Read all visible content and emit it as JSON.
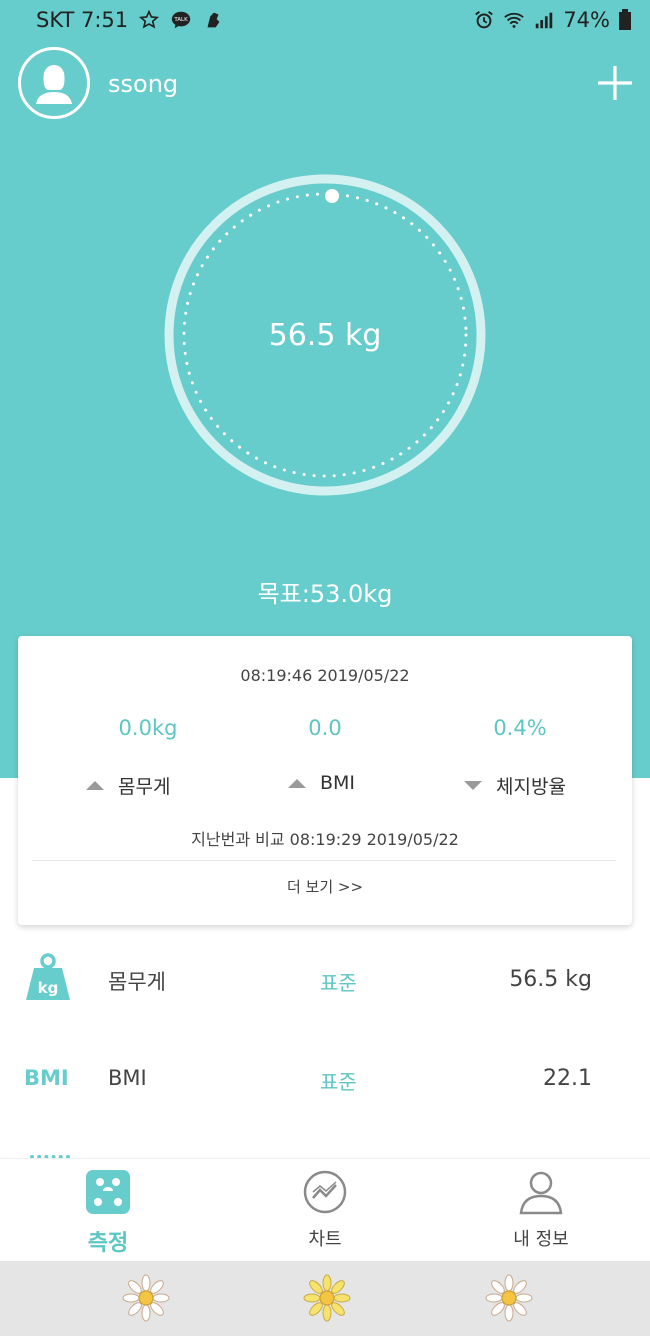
{
  "status_bar": {
    "carrier_time": "SKT 7:51",
    "battery": "74%",
    "icons": [
      "star-icon",
      "kakaotalk-icon",
      "game-icon",
      "alarm-icon",
      "wifi-icon",
      "signal-icon",
      "battery-icon"
    ]
  },
  "header": {
    "username": "ssong",
    "avatar_icon": "user-silhouette-icon",
    "add_icon": "plus-icon"
  },
  "gauge": {
    "value": "56.5 kg"
  },
  "target": {
    "text": "목표:53.0kg"
  },
  "card": {
    "timestamp": "08:19:46 2019/05/22",
    "metrics": [
      {
        "value": "0.0kg",
        "label": "몸무게",
        "trend": "up"
      },
      {
        "value": "0.0",
        "label": "BMI",
        "trend": "up"
      },
      {
        "value": "0.4%",
        "label": "체지방율",
        "trend": "down"
      }
    ],
    "compare_text": "지난번과 비교 08:19:29 2019/05/22",
    "more_link": "더 보기 >>"
  },
  "rows": [
    {
      "icon": "weight-kg-icon",
      "icon_text": "kg",
      "name": "몸무게",
      "status": "표준",
      "value": "56.5 kg"
    },
    {
      "icon": "bmi-icon",
      "icon_text": "BMI",
      "name": "BMI",
      "status": "표준",
      "value": "22.1"
    }
  ],
  "nav": {
    "items": [
      {
        "label": "측정",
        "icon": "scale-icon",
        "active": true
      },
      {
        "label": "차트",
        "icon": "chart-icon",
        "active": false
      },
      {
        "label": "내 정보",
        "icon": "profile-icon",
        "active": false
      }
    ]
  },
  "colors": {
    "primary": "#67cdcc",
    "accent_text": "#5cc6c3",
    "ring": "#d3f1f0"
  }
}
